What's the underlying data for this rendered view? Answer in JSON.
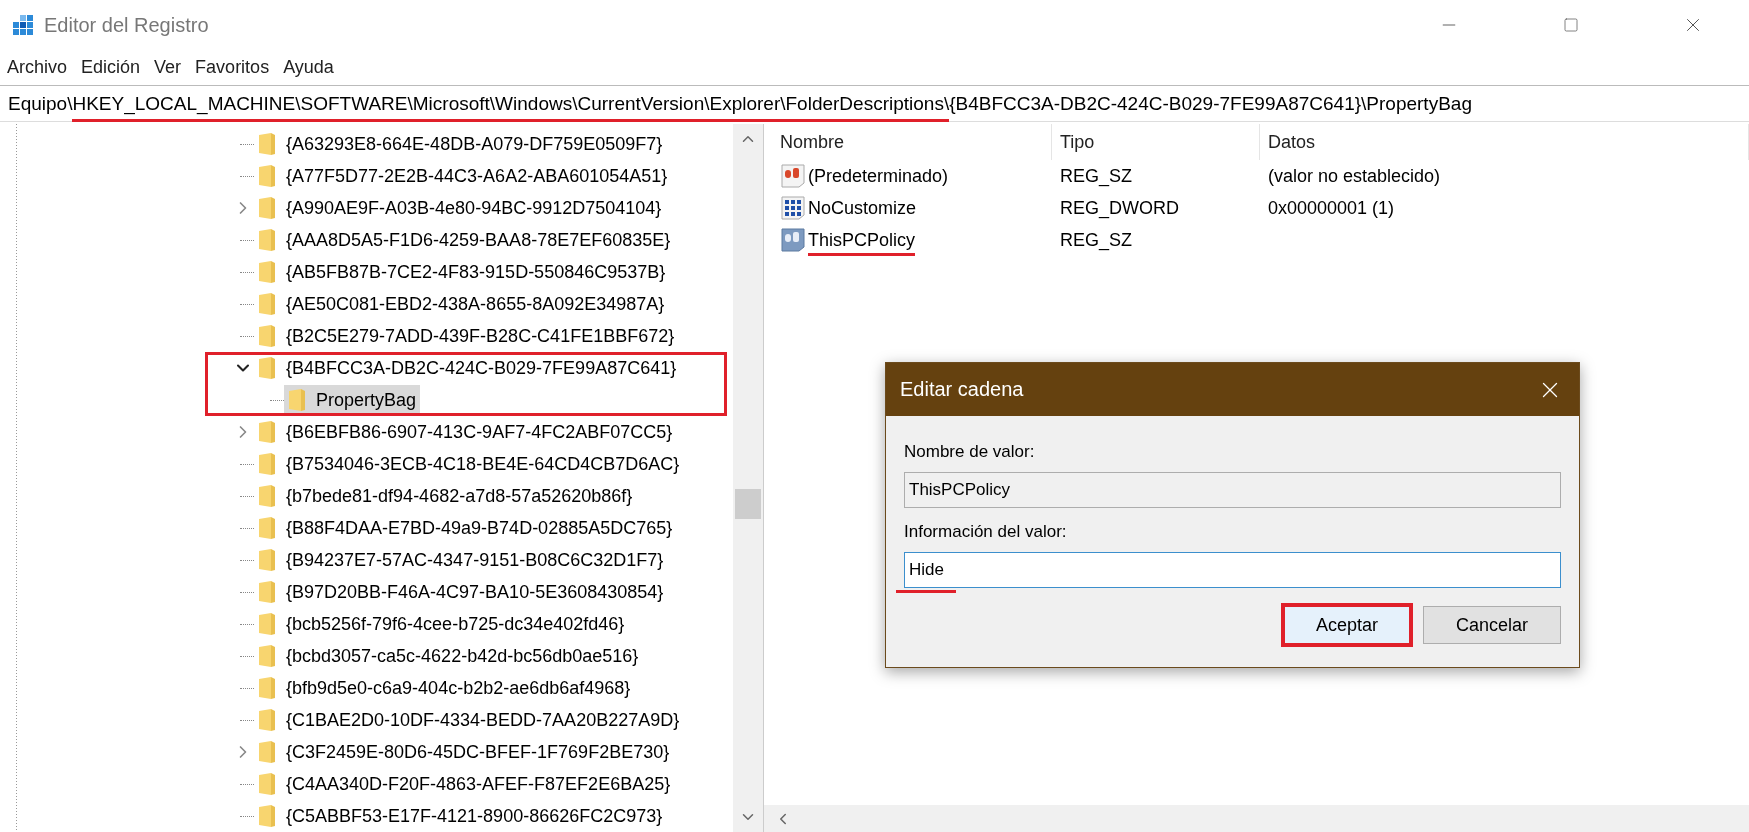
{
  "window": {
    "title": "Editor del Registro"
  },
  "menu": [
    "Archivo",
    "Edición",
    "Ver",
    "Favoritos",
    "Ayuda"
  ],
  "address": {
    "segments": [
      {
        "text": "Equipo\\",
        "underlined": false
      },
      {
        "text": "HKEY_LOCAL_MACHINE\\SOFTWARE\\Microsoft\\Windows\\CurrentVersion\\Explorer\\FolderDescriptions\\",
        "underlined": true
      },
      {
        "text": "{B4BFCC3A-DB2C-424C-B029-7FE99A87C641}\\PropertyBag",
        "underlined": false
      }
    ]
  },
  "tree": {
    "items": [
      {
        "label": "{A63293E8-664E-48DB-A079-DF759E0509F7}",
        "kind": "leaf",
        "selected": false,
        "highlighted": false
      },
      {
        "label": "{A77F5D77-2E2B-44C3-A6A2-ABA601054A51}",
        "kind": "leaf",
        "selected": false,
        "highlighted": false
      },
      {
        "label": "{A990AE9F-A03B-4e80-94BC-9912D7504104}",
        "kind": "collapsed",
        "selected": false,
        "highlighted": false
      },
      {
        "label": "{AAA8D5A5-F1D6-4259-BAA8-78E7EF60835E}",
        "kind": "leaf",
        "selected": false,
        "highlighted": false
      },
      {
        "label": "{AB5FB87B-7CE2-4F83-915D-550846C9537B}",
        "kind": "leaf",
        "selected": false,
        "highlighted": false
      },
      {
        "label": "{AE50C081-EBD2-438A-8655-8A092E34987A}",
        "kind": "leaf",
        "selected": false,
        "highlighted": false
      },
      {
        "label": "{B2C5E279-7ADD-439F-B28C-C41FE1BBF672}",
        "kind": "leaf",
        "selected": false,
        "highlighted": false
      },
      {
        "label": "{B4BFCC3A-DB2C-424C-B029-7FE99A87C641}",
        "kind": "expanded",
        "selected": false,
        "highlighted": true,
        "children": [
          {
            "label": "PropertyBag",
            "kind": "leaf",
            "selected": true,
            "highlighted": false
          }
        ]
      },
      {
        "label": "{B6EBFB86-6907-413C-9AF7-4FC2ABF07CC5}",
        "kind": "collapsed",
        "selected": false,
        "highlighted": false
      },
      {
        "label": "{B7534046-3ECB-4C18-BE4E-64CD4CB7D6AC}",
        "kind": "leaf",
        "selected": false,
        "highlighted": false
      },
      {
        "label": "{b7bede81-df94-4682-a7d8-57a52620b86f}",
        "kind": "leaf",
        "selected": false,
        "highlighted": false
      },
      {
        "label": "{B88F4DAA-E7BD-49a9-B74D-02885A5DC765}",
        "kind": "leaf",
        "selected": false,
        "highlighted": false
      },
      {
        "label": "{B94237E7-57AC-4347-9151-B08C6C32D1F7}",
        "kind": "leaf",
        "selected": false,
        "highlighted": false
      },
      {
        "label": "{B97D20BB-F46A-4C97-BA10-5E3608430854}",
        "kind": "leaf",
        "selected": false,
        "highlighted": false
      },
      {
        "label": "{bcb5256f-79f6-4cee-b725-dc34e402fd46}",
        "kind": "leaf",
        "selected": false,
        "highlighted": false
      },
      {
        "label": "{bcbd3057-ca5c-4622-b42d-bc56db0ae516}",
        "kind": "leaf",
        "selected": false,
        "highlighted": false
      },
      {
        "label": "{bfb9d5e0-c6a9-404c-b2b2-ae6db6af4968}",
        "kind": "leaf",
        "selected": false,
        "highlighted": false
      },
      {
        "label": "{C1BAE2D0-10DF-4334-BEDD-7AA20B227A9D}",
        "kind": "leaf",
        "selected": false,
        "highlighted": false
      },
      {
        "label": "{C3F2459E-80D6-45DC-BFEF-1F769F2BE730}",
        "kind": "collapsed",
        "selected": false,
        "highlighted": false
      },
      {
        "label": "{C4AA340D-F20F-4863-AFEF-F87EF2E6BA25}",
        "kind": "leaf",
        "selected": false,
        "highlighted": false
      },
      {
        "label": "{C5ABBF53-E17F-4121-8900-86626FC2C973}",
        "kind": "leaf",
        "selected": false,
        "highlighted": false
      }
    ]
  },
  "values": {
    "columns": [
      "Nombre",
      "Tipo",
      "Datos"
    ],
    "rows": [
      {
        "kind": "string",
        "name": "(Predeterminado)",
        "type": "REG_SZ",
        "data": "(valor no establecido)",
        "selected": false,
        "underlined": false
      },
      {
        "kind": "dword",
        "name": "NoCustomize",
        "type": "REG_DWORD",
        "data": "0x00000001 (1)",
        "selected": false,
        "underlined": false
      },
      {
        "kind": "string",
        "name": "ThisPCPolicy",
        "type": "REG_SZ",
        "selected": true,
        "underlined": true
      }
    ]
  },
  "dialog": {
    "title": "Editar cadena",
    "name_label": "Nombre de valor:",
    "name_value": "ThisPCPolicy",
    "data_label": "Información del valor:",
    "data_value": "Hide",
    "data_underlined": true,
    "buttons": [
      {
        "label": "Aceptar",
        "default": true,
        "highlighted": true
      },
      {
        "label": "Cancelar",
        "default": false,
        "highlighted": false
      }
    ]
  }
}
